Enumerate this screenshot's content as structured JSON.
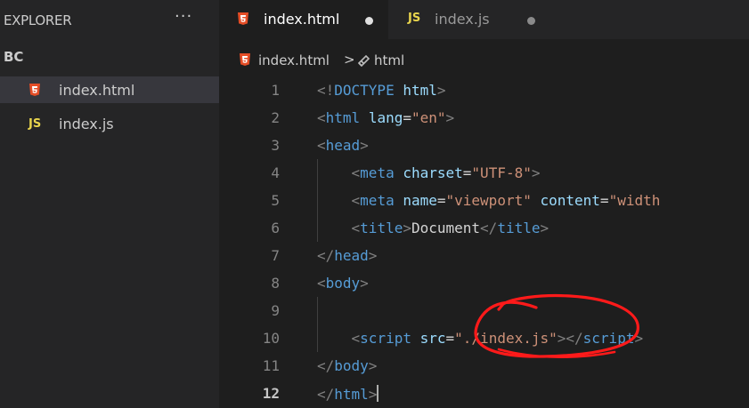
{
  "sidebar": {
    "title": "EXPLORER",
    "more": "···",
    "folder": "BC",
    "files": [
      {
        "label": "index.html",
        "icon": "html5-icon",
        "active": true
      },
      {
        "label": "index.js",
        "icon": "js-icon",
        "active": false
      }
    ]
  },
  "tabs": [
    {
      "label": "index.html",
      "icon": "html5-icon",
      "active": true,
      "modified": true
    },
    {
      "label": "index.js",
      "icon": "js-icon",
      "active": false,
      "modified": true
    }
  ],
  "icons": {
    "js_text": "JS"
  },
  "breadcrumb": {
    "file": "index.html",
    "separator": ">",
    "symbol": "html"
  },
  "editor": {
    "current_line": 12,
    "line_numbers": [
      "1",
      "2",
      "3",
      "4",
      "5",
      "6",
      "7",
      "8",
      "9",
      "10",
      "11",
      "12"
    ],
    "lines": [
      [
        {
          "t": "br",
          "v": "<!"
        },
        {
          "t": "doc",
          "v": "DOCTYPE "
        },
        {
          "t": "attr",
          "v": "html"
        },
        {
          "t": "br",
          "v": ">"
        }
      ],
      [
        {
          "t": "br",
          "v": "<"
        },
        {
          "t": "tag",
          "v": "html"
        },
        {
          "t": "txt",
          "v": " "
        },
        {
          "t": "attr",
          "v": "lang"
        },
        {
          "t": "txt",
          "v": "="
        },
        {
          "t": "str",
          "v": "\"en\""
        },
        {
          "t": "br",
          "v": ">"
        }
      ],
      [
        {
          "t": "br",
          "v": "<"
        },
        {
          "t": "tag",
          "v": "head"
        },
        {
          "t": "br",
          "v": ">"
        }
      ],
      [
        {
          "t": "txt",
          "v": "    "
        },
        {
          "t": "br",
          "v": "<"
        },
        {
          "t": "tag",
          "v": "meta"
        },
        {
          "t": "txt",
          "v": " "
        },
        {
          "t": "attr",
          "v": "charset"
        },
        {
          "t": "txt",
          "v": "="
        },
        {
          "t": "str",
          "v": "\"UTF-8\""
        },
        {
          "t": "br",
          "v": ">"
        }
      ],
      [
        {
          "t": "txt",
          "v": "    "
        },
        {
          "t": "br",
          "v": "<"
        },
        {
          "t": "tag",
          "v": "meta"
        },
        {
          "t": "txt",
          "v": " "
        },
        {
          "t": "attr",
          "v": "name"
        },
        {
          "t": "txt",
          "v": "="
        },
        {
          "t": "str",
          "v": "\"viewport\""
        },
        {
          "t": "txt",
          "v": " "
        },
        {
          "t": "attr",
          "v": "content"
        },
        {
          "t": "txt",
          "v": "="
        },
        {
          "t": "str",
          "v": "\"width"
        }
      ],
      [
        {
          "t": "txt",
          "v": "    "
        },
        {
          "t": "br",
          "v": "<"
        },
        {
          "t": "tag",
          "v": "title"
        },
        {
          "t": "br",
          "v": ">"
        },
        {
          "t": "txt",
          "v": "Document"
        },
        {
          "t": "br",
          "v": "</"
        },
        {
          "t": "tag",
          "v": "title"
        },
        {
          "t": "br",
          "v": ">"
        }
      ],
      [
        {
          "t": "br",
          "v": "</"
        },
        {
          "t": "tag",
          "v": "head"
        },
        {
          "t": "br",
          "v": ">"
        }
      ],
      [
        {
          "t": "br",
          "v": "<"
        },
        {
          "t": "tag",
          "v": "body"
        },
        {
          "t": "br",
          "v": ">"
        }
      ],
      [],
      [
        {
          "t": "txt",
          "v": "    "
        },
        {
          "t": "br",
          "v": "<"
        },
        {
          "t": "tag",
          "v": "script"
        },
        {
          "t": "txt",
          "v": " "
        },
        {
          "t": "attr",
          "v": "src"
        },
        {
          "t": "txt",
          "v": "="
        },
        {
          "t": "str",
          "v": "\"./index.js\""
        },
        {
          "t": "br",
          "v": ">"
        },
        {
          "t": "br",
          "v": "</"
        },
        {
          "t": "tag",
          "v": "script"
        },
        {
          "t": "br",
          "v": ">"
        }
      ],
      [
        {
          "t": "br",
          "v": "</"
        },
        {
          "t": "tag",
          "v": "body"
        },
        {
          "t": "br",
          "v": ">"
        }
      ],
      [
        {
          "t": "br",
          "v": "</"
        },
        {
          "t": "tag",
          "v": "html"
        },
        {
          "t": "br",
          "v": ">"
        }
      ]
    ]
  },
  "annotation": {
    "color": "#ff1a1a",
    "shape": "hand-drawn ellipse around \"./index.js\""
  },
  "colors": {
    "html5": "#e44d26",
    "js": "#e8d44d",
    "modified_dot": "#d4d4d4"
  }
}
